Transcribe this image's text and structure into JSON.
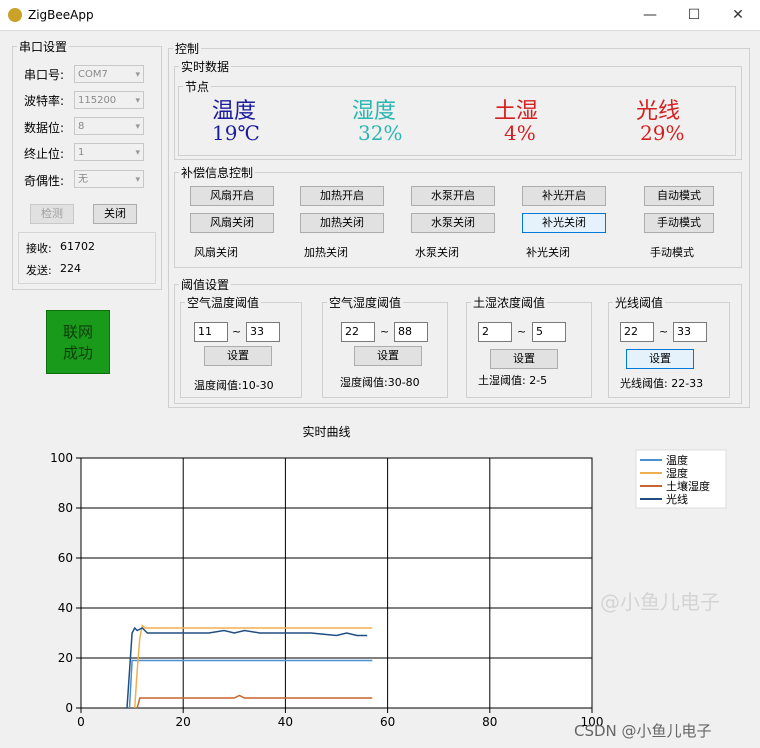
{
  "window": {
    "title": "ZigBeeApp",
    "minimize": "—",
    "maximize": "☐",
    "close": "✕"
  },
  "serial": {
    "legend": "串口设置",
    "port_label": "串口号:",
    "port_value": "COM7",
    "baud_label": "波特率:",
    "baud_value": "115200",
    "databits_label": "数据位:",
    "databits_value": "8",
    "stopbits_label": "终止位:",
    "stopbits_value": "1",
    "parity_label": "奇偶性:",
    "parity_value": "无",
    "detect_label": "检测",
    "close_label": "关闭",
    "recv_label": "接收:",
    "recv_value": "61702",
    "send_label": "发送:",
    "send_value": "224"
  },
  "network_status": {
    "line1": "联网",
    "line2": "成功",
    "color": "#1a9a1a"
  },
  "control": {
    "legend": "控制",
    "realtime_legend": "实时数据",
    "node_legend": "节点",
    "sensors": [
      {
        "name": "温度",
        "value": "19℃",
        "name_color": "#1c1c9e",
        "value_color": "#1c1c9e"
      },
      {
        "name": "湿度",
        "value": "32%",
        "name_color": "#2bb5b0",
        "value_color": "#2bb5b0"
      },
      {
        "name": "土湿",
        "value": "4%",
        "name_color": "#d42020",
        "value_color": "#d42020"
      },
      {
        "name": "光线",
        "value": "29%",
        "name_color": "#d42020",
        "value_color": "#d42020"
      }
    ],
    "comp_legend": "补偿信息控制",
    "comp_buttons_on": [
      "风扇开启",
      "加热开启",
      "水泵开启",
      "补光开启",
      "自动模式"
    ],
    "comp_buttons_off": [
      "风扇关闭",
      "加热关闭",
      "水泵关闭",
      "补光关闭",
      "手动模式"
    ],
    "comp_status": [
      "风扇关闭",
      "加热关闭",
      "水泵关闭",
      "补光关闭",
      "手动模式"
    ],
    "threshold_legend": "阈值设置",
    "thresholds": [
      {
        "title": "空气温度阈值",
        "low": "11",
        "high": "33",
        "tilde": "~",
        "button": "设置",
        "status": "温度阈值:10-30"
      },
      {
        "title": "空气湿度阈值",
        "low": "22",
        "high": "88",
        "tilde": "~",
        "button": "设置",
        "status": "湿度阈值:30-80"
      },
      {
        "title": "土湿浓度阈值",
        "low": "2",
        "high": "5",
        "tilde": "~",
        "button": "设置",
        "status": "土湿阈值: 2-5"
      },
      {
        "title": "光线阈值",
        "low": "22",
        "high": "33",
        "tilde": "~",
        "button": "设置",
        "status": "光线阈值: 22-33"
      }
    ]
  },
  "chart_data": {
    "type": "line",
    "title": "实时曲线",
    "xlim": [
      0,
      100
    ],
    "ylim": [
      0,
      100
    ],
    "xticks": [
      0,
      20,
      40,
      60,
      80,
      100
    ],
    "yticks": [
      0,
      20,
      40,
      60,
      80,
      100
    ],
    "grid": true,
    "legend_position": "top-right",
    "series": [
      {
        "name": "温度",
        "color": "#4a8fd0",
        "x": [
          9.5,
          10,
          11,
          12,
          13,
          20,
          30,
          40,
          50,
          57
        ],
        "y": [
          0,
          19,
          19,
          19,
          19,
          19,
          19,
          19,
          19,
          19
        ]
      },
      {
        "name": "湿度",
        "color": "#f0b050",
        "x": [
          10.5,
          11,
          11.5,
          12,
          12.5,
          13,
          20,
          30,
          40,
          50,
          57
        ],
        "y": [
          0,
          15,
          28,
          33,
          32,
          32,
          32,
          32,
          32,
          32,
          32
        ]
      },
      {
        "name": "土壤湿度",
        "color": "#c8642d",
        "x": [
          11,
          11.5,
          12,
          20,
          30,
          31,
          32,
          33,
          40,
          50,
          57
        ],
        "y": [
          0,
          4,
          4,
          4,
          4,
          5,
          4,
          4,
          4,
          4,
          4
        ]
      },
      {
        "name": "光线",
        "color": "#1f4f82",
        "x": [
          9,
          10,
          10.5,
          11,
          12,
          13,
          15,
          20,
          25,
          28,
          30,
          32,
          35,
          40,
          45,
          50,
          52,
          54,
          55,
          56
        ],
        "y": [
          0,
          30,
          32,
          31,
          32,
          30,
          30,
          30,
          30,
          31,
          30,
          31,
          30,
          30,
          30,
          29,
          30,
          29,
          29,
          29
        ]
      }
    ]
  },
  "watermarks": {
    "center": "@小鱼儿电子",
    "bottom": "CSDN @小鱼儿电子"
  }
}
